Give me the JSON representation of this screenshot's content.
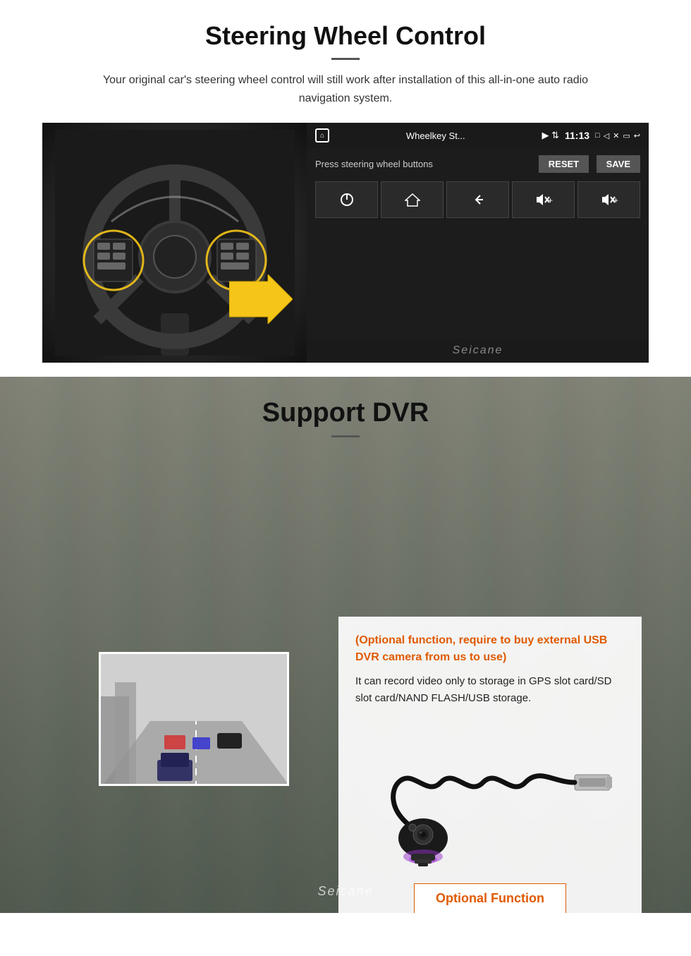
{
  "steering": {
    "section_title": "Steering Wheel Control",
    "description": "Your original car's steering wheel control will still work after installation of this all-in-one auto radio navigation system.",
    "android_app_name": "Wheelkey St...",
    "android_time": "11:13",
    "press_instruction": "Press steering wheel buttons",
    "btn_reset": "RESET",
    "btn_save": "SAVE",
    "control_buttons": [
      "⏻",
      "⌂",
      "↩",
      "🔊+",
      "🔊+"
    ],
    "brand": "Seicane"
  },
  "dvr": {
    "section_title": "Support DVR",
    "optional_note": "(Optional function, require to buy external USB DVR camera from us to use)",
    "description": "It can record video only to storage in GPS slot card/SD slot card/NAND FLASH/USB storage.",
    "optional_function_label": "Optional Function",
    "brand": "Seicane"
  }
}
